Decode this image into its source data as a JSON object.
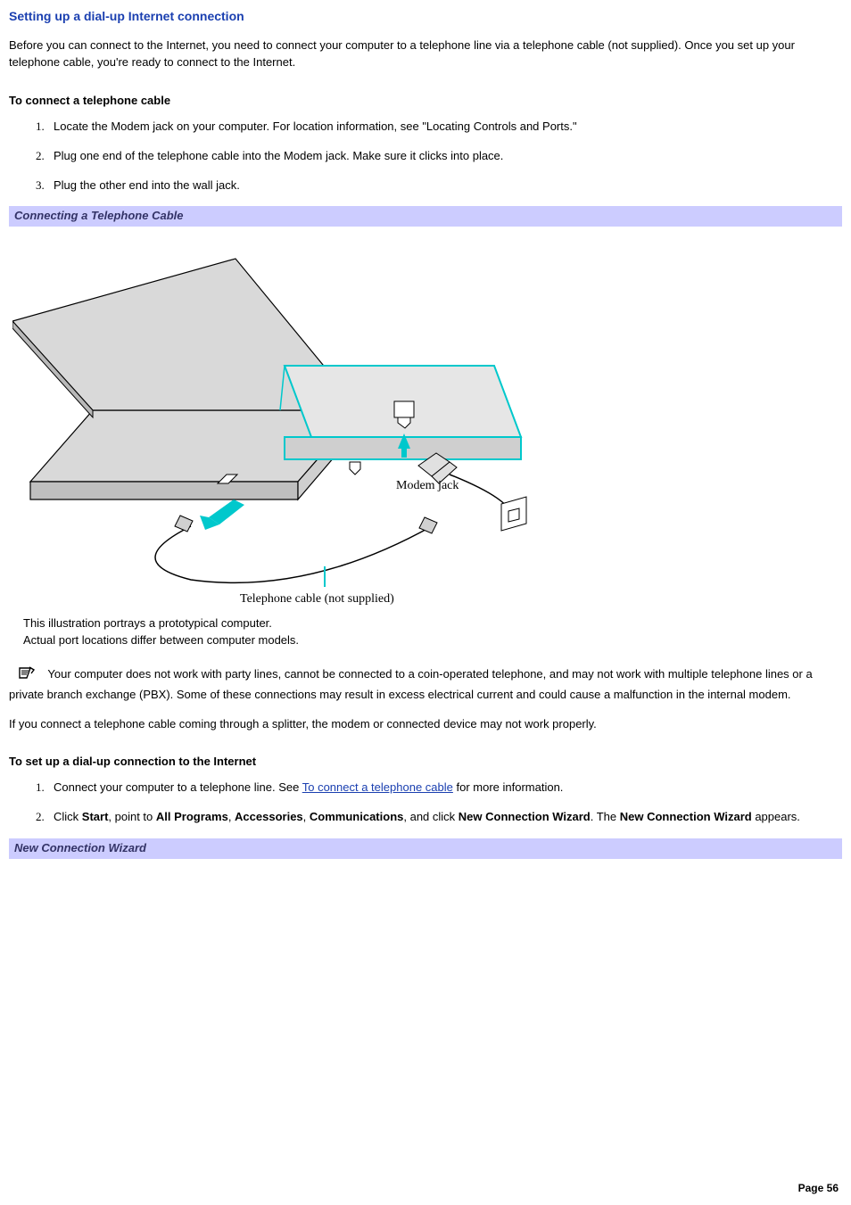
{
  "title": "Setting up a dial-up Internet connection",
  "intro": "Before you can connect to the Internet, you need to connect your computer to a telephone line via a telephone cable (not supplied). Once you set up your telephone cable, you're ready to connect to the Internet.",
  "section1_heading": "To connect a telephone cable",
  "steps1": {
    "n1": "1.",
    "t1": "Locate the Modem jack on your computer. For location information, see \"Locating Controls and Ports.\"",
    "n2": "2.",
    "t2": "Plug one end of the telephone cable into the Modem jack. Make sure it clicks into place.",
    "n3": "3.",
    "t3": "Plug the other end into the wall jack."
  },
  "figure1_band": "Connecting a Telephone Cable",
  "figure1_labels": {
    "modem_jack": "Modem jack",
    "cable_caption": "Telephone cable (not supplied)"
  },
  "figure1_notes": {
    "l1": "This illustration portrays a prototypical computer.",
    "l2": "Actual port locations differ between computer models."
  },
  "note1": "Your computer does not work with party lines, cannot be connected to a coin-operated telephone, and may not work with multiple telephone lines or a private branch exchange (PBX). Some of these connections may result in excess electrical current and could cause a malfunction in the internal modem.",
  "note2": "If you connect a telephone cable coming through a splitter, the modem or connected device may not work properly.",
  "section2_heading": "To set up a dial-up connection to the Internet",
  "steps2": {
    "n1": "1.",
    "t1a": "Connect your computer to a telephone line. See ",
    "t1_link": "To connect a telephone cable",
    "t1b": " for more information.",
    "n2": "2.",
    "t2a": "Click ",
    "t2_start": "Start",
    "t2b": ", point to ",
    "t2_allprog": "All Programs",
    "t2c": ", ",
    "t2_acc": "Accessories",
    "t2d": ", ",
    "t2_comm": "Communications",
    "t2e": ", and click ",
    "t2_ncw": "New Connection Wizard",
    "t2f": ". The ",
    "t2_ncw2": "New Connection Wizard",
    "t2g": " appears."
  },
  "figure2_band": "New Connection Wizard",
  "page_label": "Page 56"
}
